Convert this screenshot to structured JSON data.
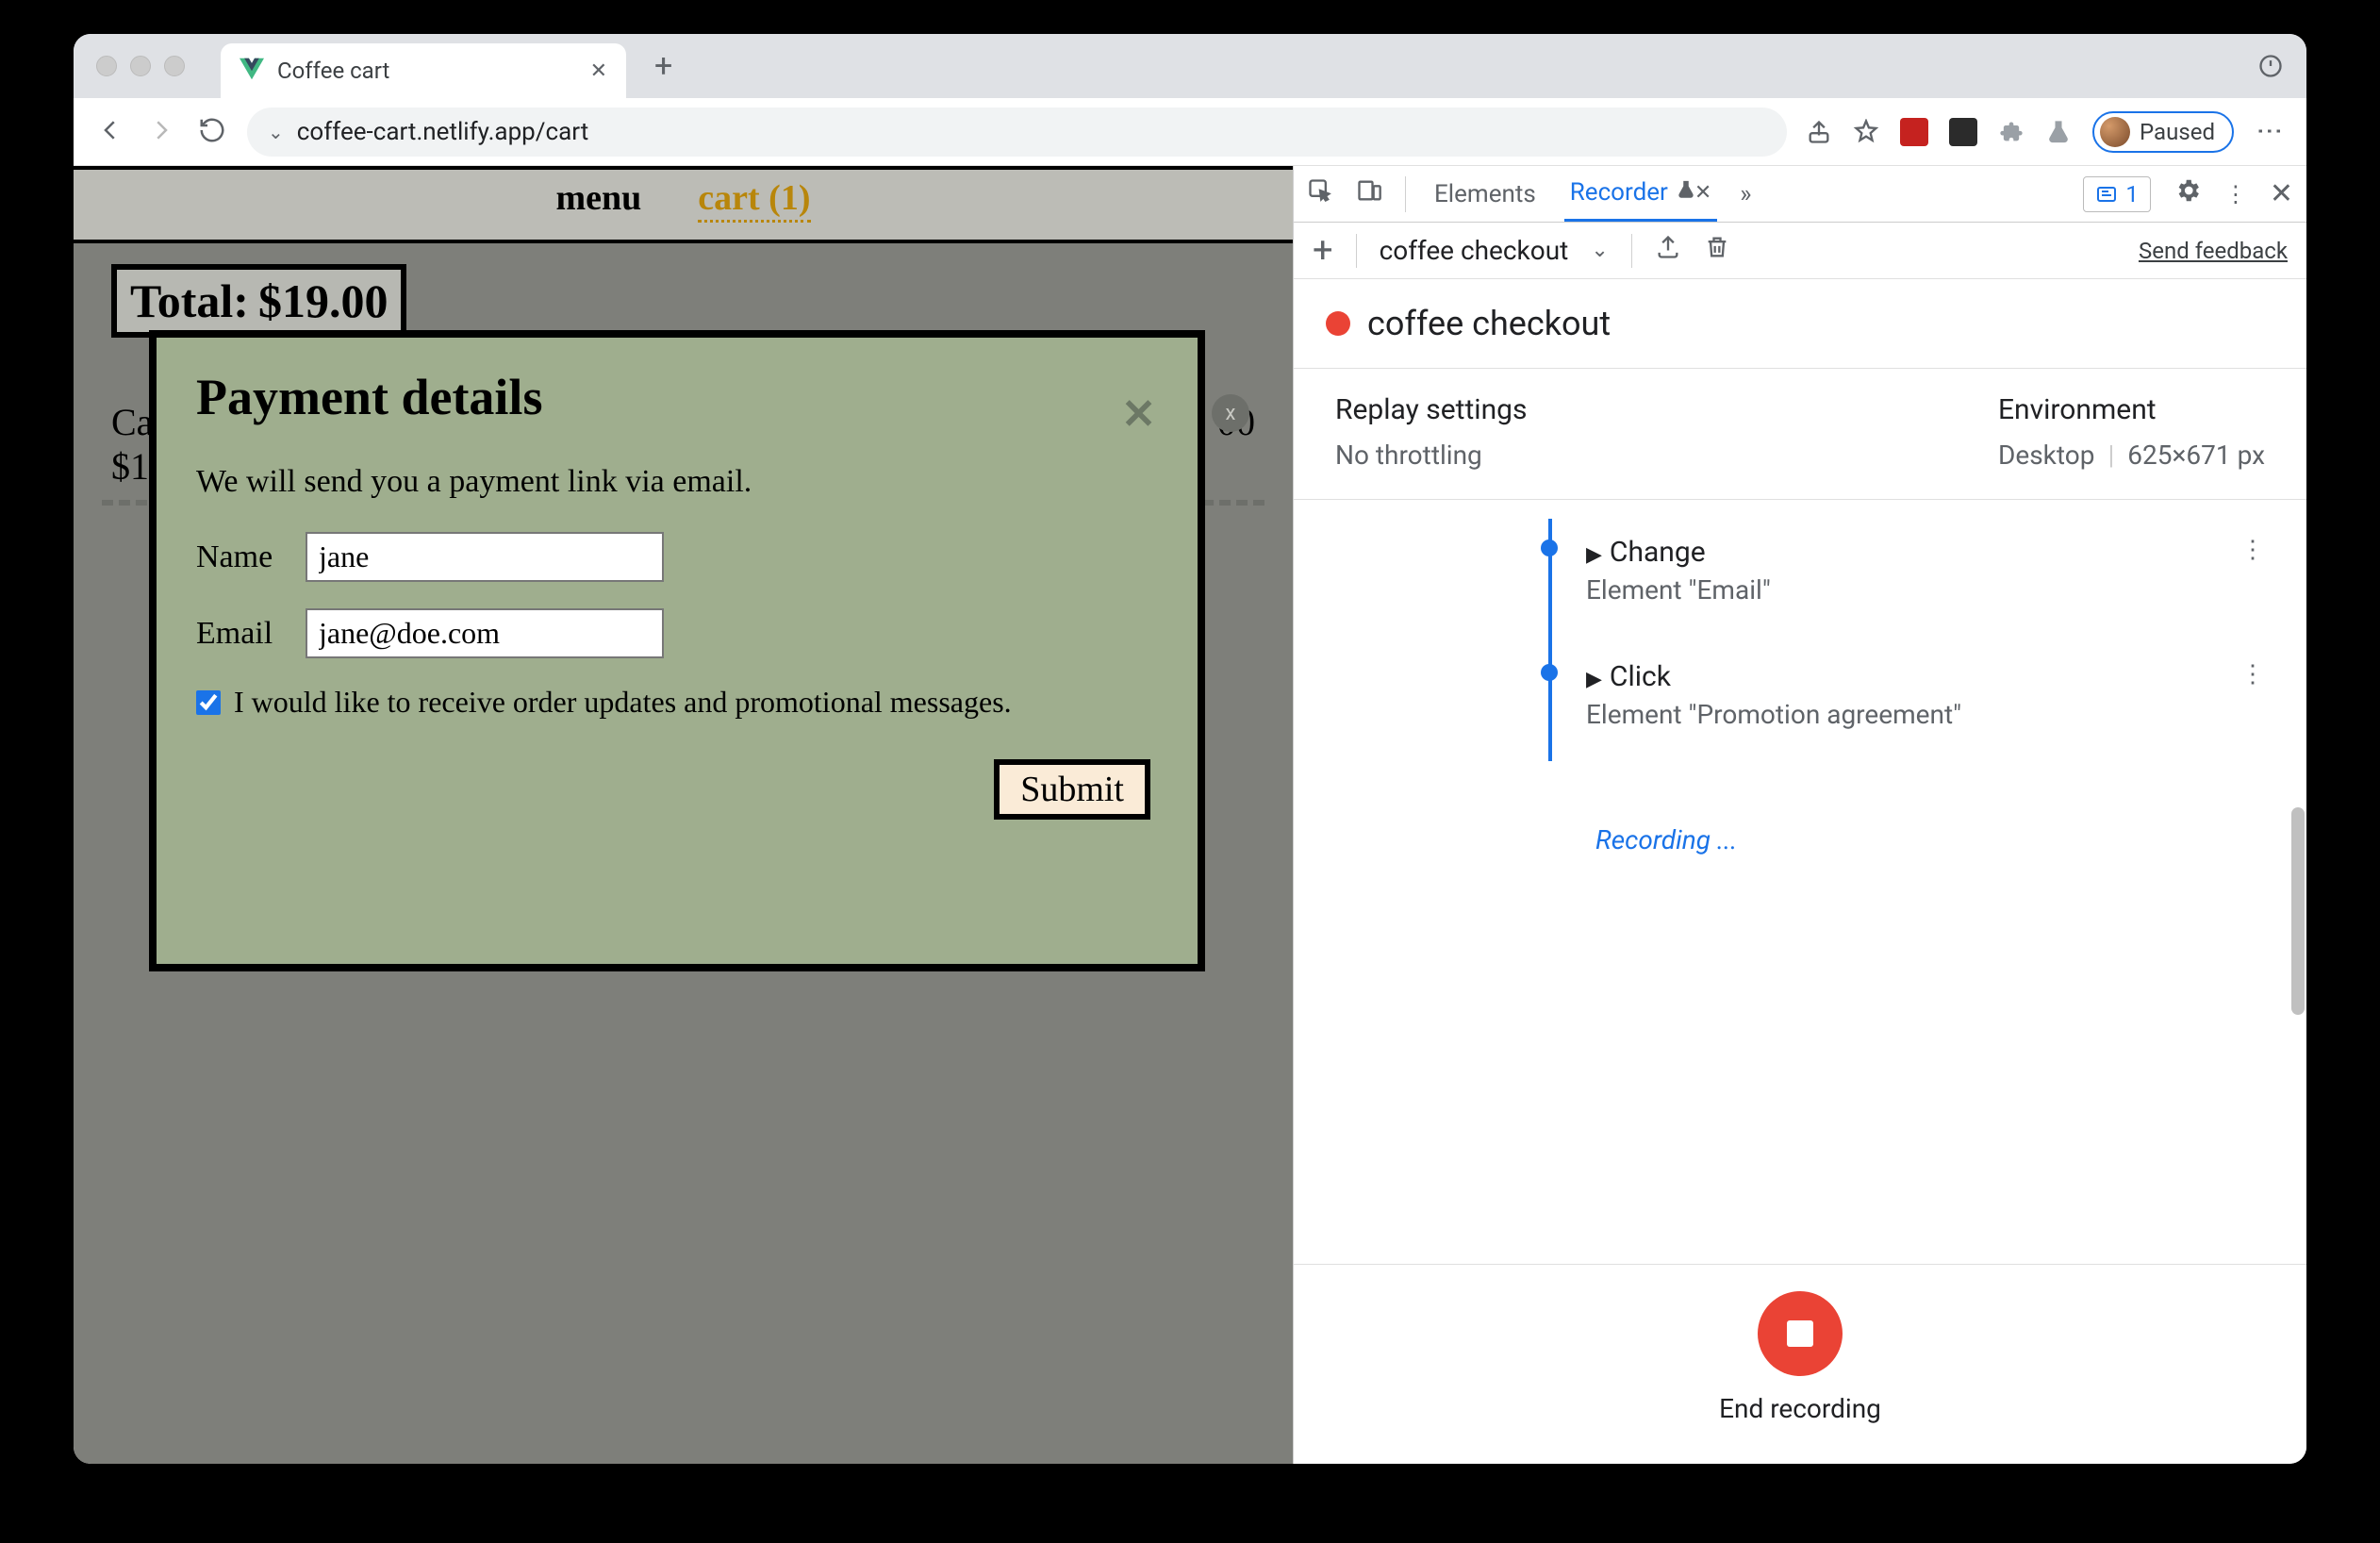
{
  "browser": {
    "tab_title": "Coffee cart",
    "url": "coffee-cart.netlify.app/cart",
    "profile_status": "Paused"
  },
  "page": {
    "nav": {
      "menu": "menu",
      "cart": "cart (1)"
    },
    "total_label": "Total:",
    "total_value": "$19.00",
    "cart_item": {
      "name_clipped": "Ca",
      "price_clipped_left": "$1",
      "price_right": "00"
    },
    "remove_badge": "x"
  },
  "modal": {
    "title": "Payment details",
    "subtitle": "We will send you a payment link via email.",
    "name_label": "Name",
    "name_value": "jane",
    "email_label": "Email",
    "email_value": "jane@doe.com",
    "promo_label": "I would like to receive order updates and promotional messages.",
    "submit": "Submit",
    "close_glyph": "✕"
  },
  "devtools": {
    "tabs": {
      "elements": "Elements",
      "recorder": "Recorder"
    },
    "issues_count": "1",
    "recorder_toolbar": {
      "recording_name": "coffee checkout",
      "send_feedback": "Send feedback"
    },
    "title": "coffee checkout",
    "settings": {
      "replay_h": "Replay settings",
      "replay_v": "No throttling",
      "env_h": "Environment",
      "env_device": "Desktop",
      "env_dims": "625×671 px"
    },
    "steps": [
      {
        "title": "Change",
        "sub": "Element \"Email\""
      },
      {
        "title": "Click",
        "sub": "Element \"Promotion agreement\""
      }
    ],
    "recording_label": "Recording ...",
    "end_label": "End recording"
  }
}
